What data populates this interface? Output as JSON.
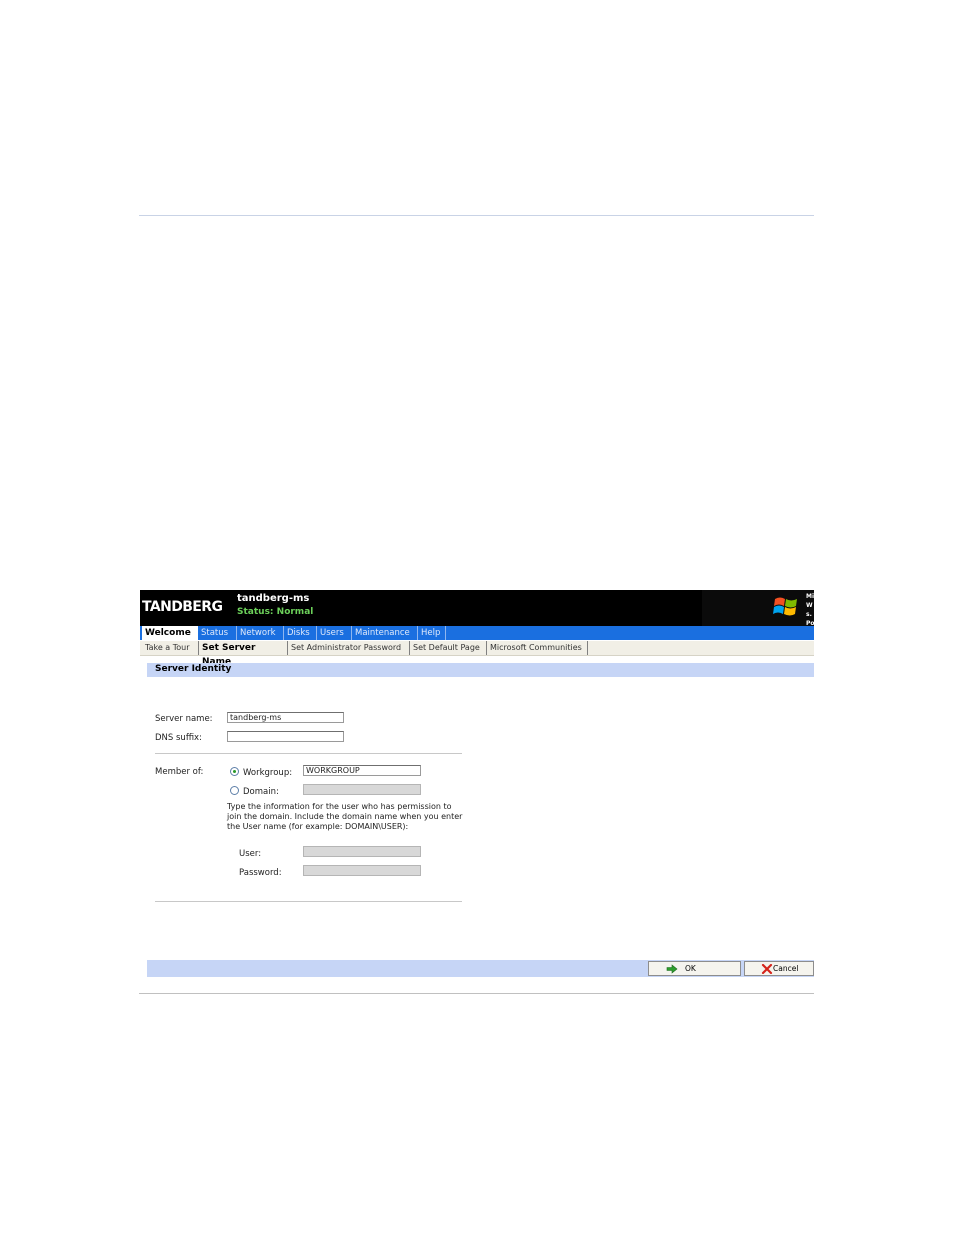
{
  "header": {
    "logo": "TANDBERG",
    "server_name": "tandberg-ms",
    "status": "Status: Normal",
    "ms_label_lines": [
      "Mi",
      "W",
      "s. Po"
    ]
  },
  "nav": {
    "tabs": [
      {
        "label": "Welcome",
        "active": true
      },
      {
        "label": "Status"
      },
      {
        "label": "Network"
      },
      {
        "label": "Disks"
      },
      {
        "label": "Users"
      },
      {
        "label": "Maintenance"
      },
      {
        "label": "Help"
      }
    ]
  },
  "subnav": {
    "items": [
      {
        "label": "Take a Tour"
      },
      {
        "label": "Set Server Name",
        "active": true
      },
      {
        "label": "Set Administrator Password"
      },
      {
        "label": "Set Default Page"
      },
      {
        "label": "Microsoft Communities"
      }
    ]
  },
  "section": {
    "title": "Server Identity"
  },
  "form": {
    "server_name_label": "Server name:",
    "server_name_value": "tandberg-ms",
    "dns_suffix_label": "DNS suffix:",
    "dns_suffix_value": "",
    "member_of_label": "Member of:",
    "workgroup_label": "Workgroup:",
    "workgroup_value": "WORKGROUP",
    "domain_label": "Domain:",
    "domain_value": "",
    "help_text": "Type the information for the user who has permission to join the domain. Include the domain name when you enter the User name (for example: DOMAIN\\USER):",
    "user_label": "User:",
    "user_value": "",
    "password_label": "Password:",
    "password_value": ""
  },
  "footer": {
    "ok_label": "OK",
    "cancel_label": "Cancel"
  },
  "colors": {
    "nav_bar": "#1a6fe0",
    "section_bar": "#c6d5f6",
    "status_green": "#6cd05a"
  }
}
